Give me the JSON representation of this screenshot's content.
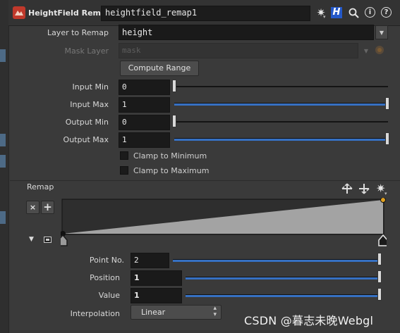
{
  "header": {
    "node_type": "HeightField Remap",
    "node_name": "heightfield_remap1",
    "icons": [
      "gear-icon",
      "help-h-icon",
      "search-icon",
      "info-icon",
      "help-icon"
    ],
    "h_glyph": "H",
    "info_glyph": "i",
    "help_glyph": "?"
  },
  "params": {
    "layer": {
      "label": "Layer to Remap",
      "value": "height"
    },
    "mask": {
      "label": "Mask Layer",
      "placeholder": "mask"
    },
    "compute_range": "Compute Range",
    "input_min": {
      "label": "Input Min",
      "value": "0",
      "fraction": 0.0
    },
    "input_max": {
      "label": "Input Max",
      "value": "1",
      "fraction": 1.0
    },
    "output_min": {
      "label": "Output Min",
      "value": "0",
      "fraction": 0.0
    },
    "output_max": {
      "label": "Output Max",
      "value": "1",
      "fraction": 1.0
    },
    "clamp_min": {
      "label": "Clamp to Minimum",
      "checked": false
    },
    "clamp_max": {
      "label": "Clamp to Maximum",
      "checked": false
    }
  },
  "remap": {
    "label": "Remap",
    "delete_glyph": "×",
    "add_glyph": "+",
    "ramp_points": [
      {
        "position": 0,
        "value": 0
      },
      {
        "position": 1,
        "value": 1
      }
    ],
    "selected_point": 2
  },
  "point": {
    "point_no": {
      "label": "Point No.",
      "value": "2",
      "fraction": 1.0
    },
    "position": {
      "label": "Position",
      "value": "1",
      "fraction": 1.0
    },
    "value": {
      "label": "Value",
      "value": "1",
      "fraction": 1.0
    },
    "interpolation": {
      "label": "Interpolation",
      "value": "Linear"
    }
  },
  "watermark": "CSDN @暮志未晚Webgl",
  "colors": {
    "accent": "#3670c2",
    "selected_point": "#e0a020",
    "ramp_fill": "#a3a3a3"
  }
}
